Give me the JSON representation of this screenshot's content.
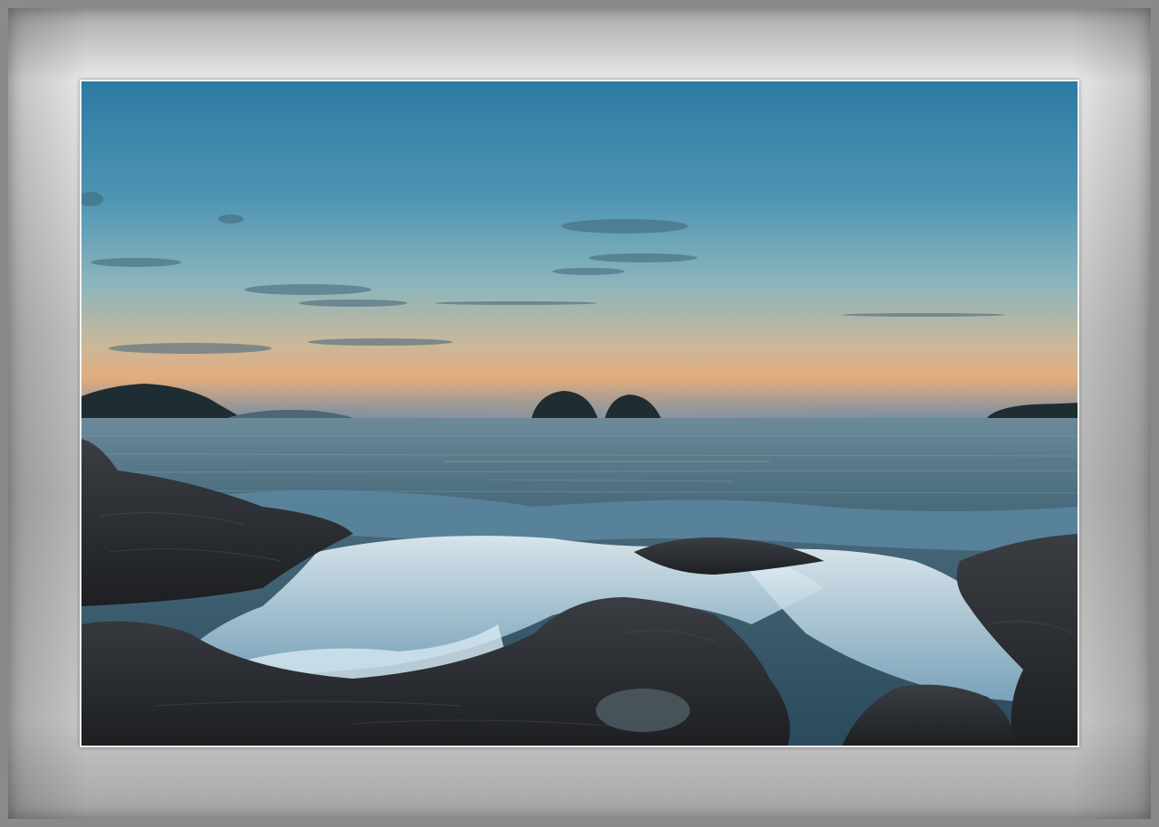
{
  "image": {
    "subject": "",
    "colors": {
      "frame": "#8a8a8a",
      "mat_light": "#e9e9e9",
      "mat_dark": "#a9a9a9",
      "sky_top": "#2f7fa6",
      "sky_mid": "#7fb0bf",
      "horizon_glow": "#e8b07a",
      "sea": "#3a5f72",
      "foam": "#cfe3ee",
      "rock": "#2a2d31"
    }
  }
}
